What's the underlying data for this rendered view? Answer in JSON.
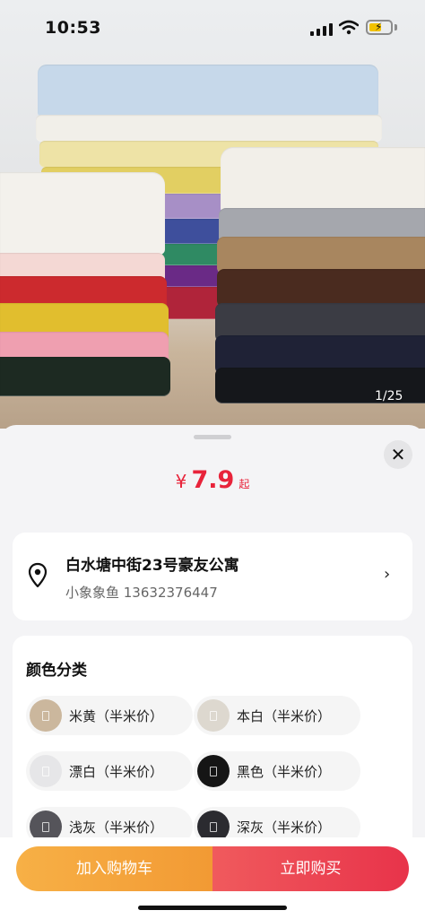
{
  "status_bar": {
    "time": "10:53",
    "battery_level": 0.6
  },
  "gallery": {
    "counter": "1/25"
  },
  "price": {
    "currency": "¥",
    "amount": "7.9",
    "suffix": "起"
  },
  "address": {
    "title": "白水塘中街23号豪友公寓",
    "contact": "小象象鱼 13632376447"
  },
  "color_section": {
    "title": "颜色分类",
    "options": [
      {
        "label": "米黄（半米价）",
        "swatch": "#cbb79d"
      },
      {
        "label": "本白（半米价）",
        "swatch": "#ddd8cf"
      },
      {
        "label": "漂白（半米价）",
        "swatch": "#e6e6e8"
      },
      {
        "label": "黑色（半米价）",
        "swatch": "#151515"
      },
      {
        "label": "浅灰（半米价）",
        "swatch": "#55545a"
      },
      {
        "label": "深灰（半米价）",
        "swatch": "#2b2b30"
      }
    ]
  },
  "actions": {
    "add_to_cart": "加入购物车",
    "buy_now": "立即购买"
  },
  "colors": {
    "accent_red": "#e8233a",
    "cart_orange": "#f29a34",
    "buy_red": "#e8334a"
  }
}
